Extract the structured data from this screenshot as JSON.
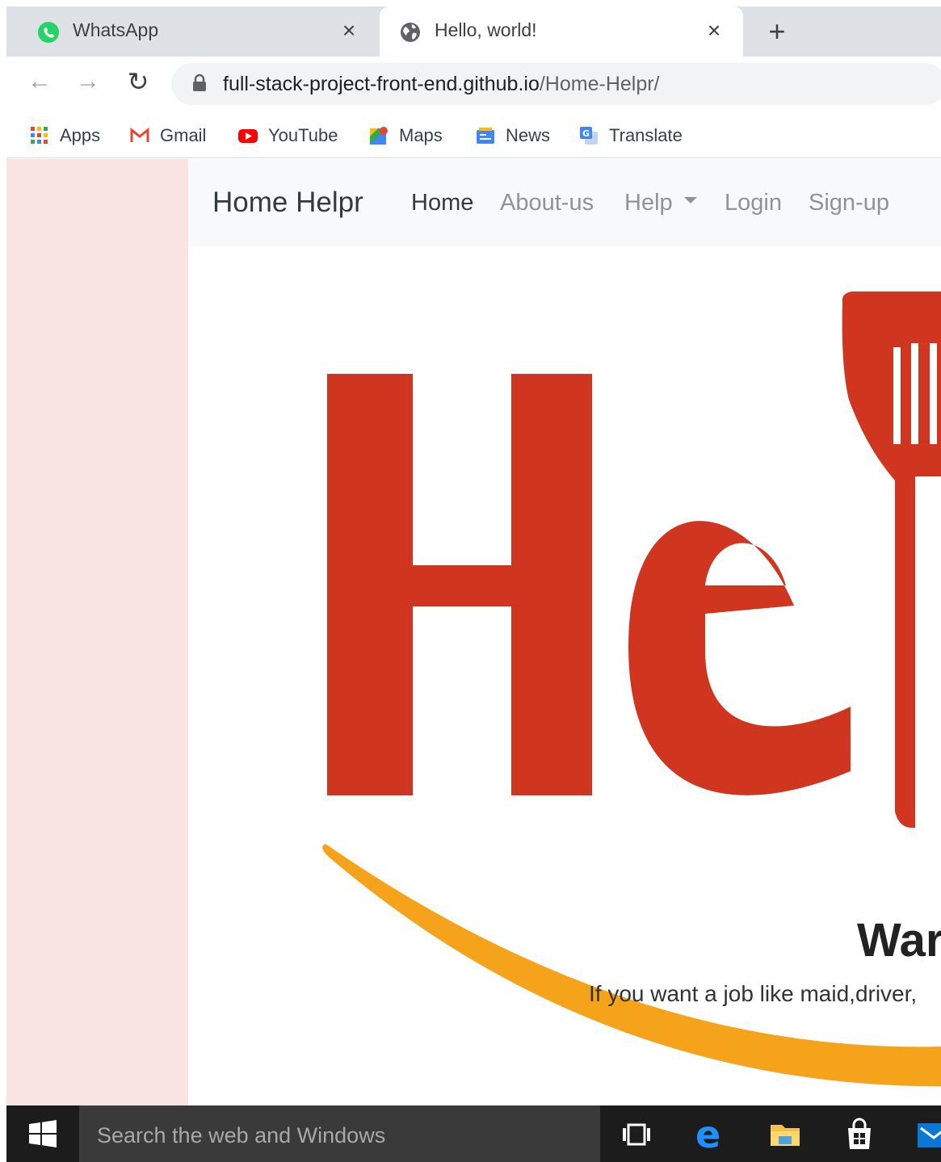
{
  "browser": {
    "tabs": [
      {
        "title": "WhatsApp",
        "favicon": "whatsapp-icon",
        "active": false
      },
      {
        "title": "Hello, world!",
        "favicon": "globe-icon",
        "active": true
      }
    ],
    "close_glyph": "×",
    "new_tab_glyph": "+",
    "url_host": "full-stack-project-front-end.github.io",
    "url_path": "/Home-Helpr/",
    "bookmarks": [
      {
        "label": "Apps",
        "icon": "apps-grid-icon"
      },
      {
        "label": "Gmail",
        "icon": "gmail-icon"
      },
      {
        "label": "YouTube",
        "icon": "youtube-icon"
      },
      {
        "label": "Maps",
        "icon": "maps-icon"
      },
      {
        "label": "News",
        "icon": "news-icon"
      },
      {
        "label": "Translate",
        "icon": "translate-icon"
      }
    ]
  },
  "site": {
    "brand": "Home Helpr",
    "nav": [
      {
        "label": "Home",
        "active": true
      },
      {
        "label": "About-us",
        "active": false
      },
      {
        "label": "Help",
        "active": false,
        "dropdown": true
      },
      {
        "label": "Login",
        "active": false
      },
      {
        "label": "Sign-up",
        "active": false
      }
    ],
    "hero_heading": "War",
    "hero_subtext": "If you want a job like maid,driver,",
    "logo_colors": {
      "red": "#d0361f",
      "orange": "#f5a31a"
    }
  },
  "taskbar": {
    "search_placeholder": "Search the web and Windows",
    "icons": [
      "task-view-icon",
      "edge-icon",
      "file-explorer-icon",
      "store-icon",
      "mail-icon"
    ]
  },
  "colors": {
    "tab_strip": "#dee1e6",
    "page_bg": "#fae3e3",
    "navbar_bg": "#f8f9fa",
    "taskbar": "#1c1c1c",
    "windows_blue": "#0a78d7"
  }
}
